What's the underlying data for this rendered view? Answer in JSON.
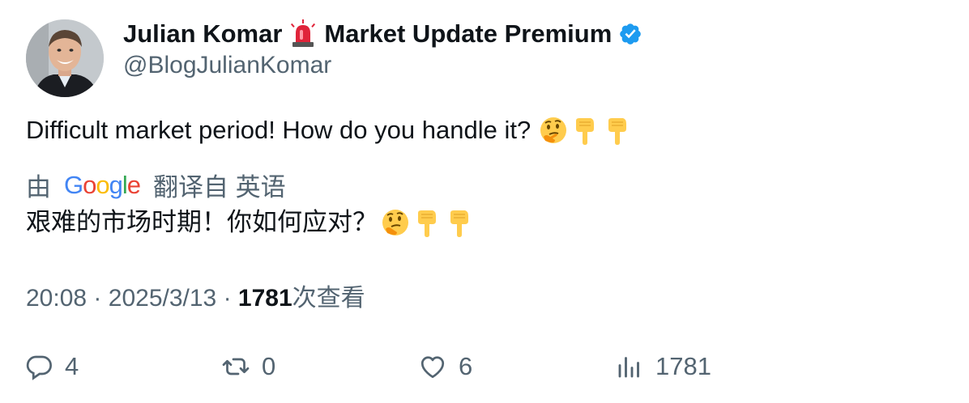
{
  "author": {
    "display_name_part1": "Julian Komar",
    "display_name_part2": "Market Update Premium",
    "handle": "@BlogJulianKomar",
    "verified_color": "#1d9bf0"
  },
  "tweet": {
    "text": "Difficult market period! How do you handle it?",
    "emoji_names": [
      "thinking-face",
      "backhand-index-pointing-down",
      "backhand-index-pointing-down"
    ]
  },
  "translation": {
    "prefix": "由",
    "provider_logo_text": "Google",
    "suffix": "翻译自 英语",
    "translated_text": "艰难的市场时期！你如何应对？"
  },
  "meta": {
    "time": "20:08",
    "separator": "·",
    "date": "2025/3/13",
    "views_count": "1781",
    "views_suffix": "次查看"
  },
  "actions": {
    "reply_count": "4",
    "retweet_count": "0",
    "like_count": "6",
    "views_count": "1781"
  },
  "colors": {
    "text": "#0f1419",
    "secondary": "#536471",
    "verified": "#1d9bf0"
  }
}
